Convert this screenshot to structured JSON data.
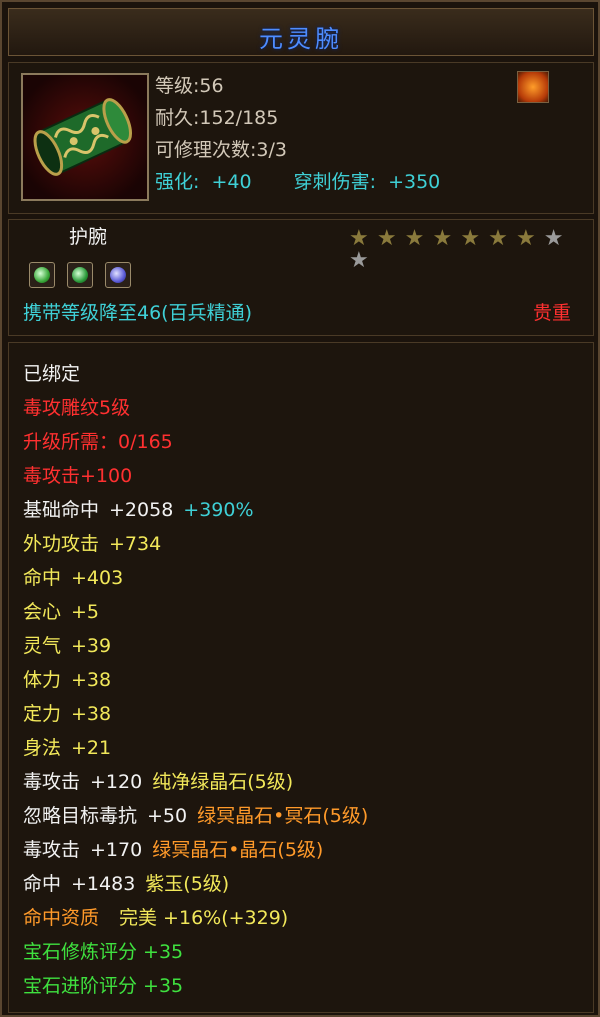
{
  "title": "元灵腕",
  "colors": {
    "title": "#4e8cff",
    "cyan": "#3fd0d6",
    "red": "#ff3030",
    "yellow": "#f2e85a",
    "orange": "#ff9a2a",
    "green": "#3fe13f",
    "grey_text": "#d2c8b8"
  },
  "icons": {
    "item": "jade-bracer-icon",
    "corner": "fire-sigil-icon",
    "gems": [
      "green-gem-icon",
      "green-gem-icon",
      "purple-gem-icon"
    ]
  },
  "header": {
    "level": "等级:56",
    "durability": "耐久:152/185",
    "repairs": "可修理次数:3/3",
    "enhance_label": "强化:",
    "enhance_value": "+40",
    "pierce_label": "穿刺伤害:",
    "pierce_value": "+350"
  },
  "slot": {
    "type": "护腕",
    "star_rating": {
      "filled": 7,
      "total": 9
    },
    "level_req": "携带等级降至46(百兵精通)",
    "rarity": "贵重"
  },
  "attributes": {
    "bound": "已绑定",
    "engrave": "毒攻雕纹5级",
    "upgrade_need": "升级所需：0/165",
    "poison_attack": "毒攻击+100",
    "base_hit_label": "基础命中",
    "base_hit_value": "+2058",
    "base_hit_pct": "+390%",
    "outer_attack_label": "外功攻击",
    "outer_attack_value": "+734",
    "hit_label": "命中",
    "hit_value": "+403",
    "crit_label": "会心",
    "crit_value": "+5",
    "spirit_label": "灵气",
    "spirit_value": "+39",
    "stamina_label": "体力",
    "stamina_value": "+38",
    "focus_label": "定力",
    "focus_value": "+38",
    "agility_label": "身法",
    "agility_value": "+21",
    "gem1_label": "毒攻击",
    "gem1_value": "+120",
    "gem1_name": "纯净绿晶石(5级)",
    "gem2_label": "忽略目标毒抗",
    "gem2_value": "+50",
    "gem2_name": "绿冥晶石•冥石(5级)",
    "gem3_label": "毒攻击",
    "gem3_value": "+170",
    "gem3_name": "绿冥晶石•晶石(5级)",
    "gem4_label": "命中",
    "gem4_value": "+1483",
    "gem4_name": "紫玉(5级)",
    "aptitude": "命中资质",
    "aptitude_value": "完美 +16%(+329)",
    "gem_refine": "宝石修炼评分 +35",
    "gem_advance": "宝石进阶评分 +35"
  }
}
